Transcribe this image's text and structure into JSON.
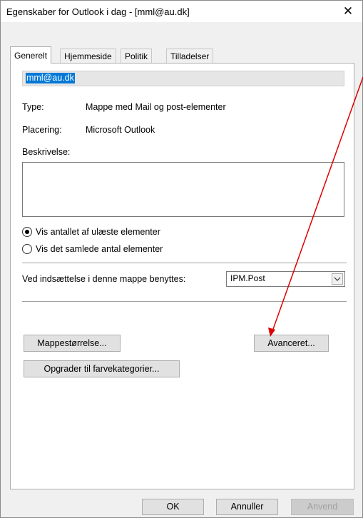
{
  "window": {
    "title": "Egenskaber for Outlook i dag - [mml@au.dk]",
    "close_glyph": "✕"
  },
  "tabs": [
    {
      "label": "Generelt",
      "active": true
    },
    {
      "label": "Hjemmeside",
      "active": false
    },
    {
      "label": "Politik",
      "active": false
    },
    {
      "label": "Tilladelser",
      "active": false
    }
  ],
  "general": {
    "folder_name": "mml@au.dk",
    "type_label": "Type:",
    "type_value": "Mappe med Mail og post-elementer",
    "location_label": "Placering:",
    "location_value": "Microsoft Outlook",
    "description_label": "Beskrivelse:",
    "description_value": "",
    "radio_unread_label": "Vis antallet af ulæste elementer",
    "radio_total_label": "Vis det samlede antal elementer",
    "radio_selected": "unread",
    "post_label": "Ved indsættelse i denne mappe benyttes:",
    "post_value": "IPM.Post",
    "folder_size_button": "Mappestørrelse...",
    "advanced_button": "Avanceret...",
    "upgrade_button": "Opgrader til farvekategorier..."
  },
  "footer": {
    "ok": "OK",
    "cancel": "Annuller",
    "apply": "Anvend"
  },
  "annotation": {
    "arrow_color": "#e00000"
  },
  "colors": {
    "selection": "#0078d7",
    "dialog_bg": "#f0f0f0",
    "button_bg": "#e1e1e1"
  }
}
